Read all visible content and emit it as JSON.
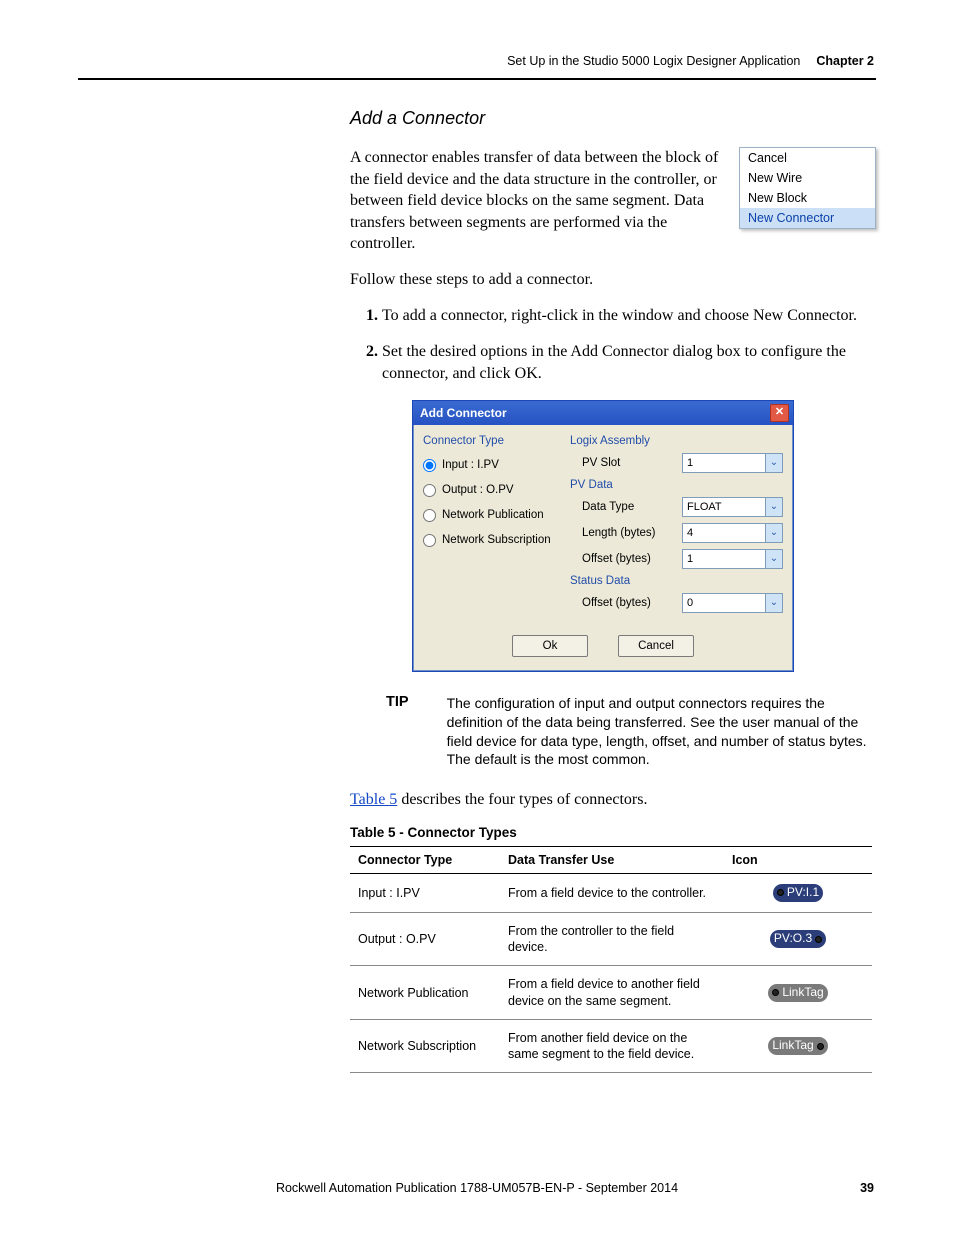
{
  "header": {
    "section": "Set Up in the Studio 5000 Logix Designer Application",
    "chapter": "Chapter 2"
  },
  "section_title": "Add a Connector",
  "intro": "A connector enables transfer of data between the block of the field device and the data structure in the controller, or between field device blocks on the same segment. Data transfers between segments are performed via the controller.",
  "follow": "Follow these steps to add a connector.",
  "context_menu": {
    "items": [
      "Cancel",
      "New Wire",
      "New Block",
      "New Connector"
    ],
    "selected_index": 3
  },
  "steps": [
    "To add a connector, right-click in the window and choose New Connector.",
    "Set the desired options in the Add Connector dialog box to configure the connector, and click OK."
  ],
  "dialog": {
    "title": "Add Connector",
    "connector_type_label": "Connector Type",
    "radios": [
      {
        "label": "Input : I.PV",
        "checked": true
      },
      {
        "label": "Output : O.PV",
        "checked": false
      },
      {
        "label": "Network Publication",
        "checked": false
      },
      {
        "label": "Network Subscription",
        "checked": false
      }
    ],
    "logix_assembly_label": "Logix Assembly",
    "pv_slot_label": "PV Slot",
    "pv_slot_value": "1",
    "pv_data_label": "PV Data",
    "data_type_label": "Data Type",
    "data_type_value": "FLOAT",
    "length_label": "Length (bytes)",
    "length_value": "4",
    "offset_label": "Offset (bytes)",
    "offset_value": "1",
    "status_data_label": "Status Data",
    "status_offset_label": "Offset (bytes)",
    "status_offset_value": "0",
    "ok_label": "Ok",
    "cancel_label": "Cancel"
  },
  "tip": {
    "label": "TIP",
    "body": "The configuration of input and output connectors requires the definition of the data being transferred. See the user manual of the field device for data type, length, offset, and number of status bytes. The default is the most common."
  },
  "table_ref_sentence_pre": "Table 5",
  "table_ref_sentence_post": " describes the four types of connectors.",
  "table_title": "Table 5 - Connector Types",
  "table": {
    "headers": [
      "Connector Type",
      "Data Transfer Use",
      "Icon"
    ],
    "rows": [
      {
        "type": "Input : I.PV",
        "use": "From a field device to the controller.",
        "icon_text": "PV:I.1",
        "icon_style": "navy",
        "dot_left": true,
        "dot_right": false
      },
      {
        "type": "Output : O.PV",
        "use": "From the controller to the field device.",
        "icon_text": "PV:O.3",
        "icon_style": "navy",
        "dot_left": false,
        "dot_right": true
      },
      {
        "type": "Network Publication",
        "use": "From a field device to another field device on the same segment.",
        "icon_text": "LinkTag",
        "icon_style": "grey",
        "dot_left": true,
        "dot_right": false
      },
      {
        "type": "Network Subscription",
        "use": "From another field device on the same segment to the field device.",
        "icon_text": "LinkTag",
        "icon_style": "grey",
        "dot_left": false,
        "dot_right": true
      }
    ]
  },
  "footer": {
    "publication": "Rockwell Automation Publication 1788-UM057B-EN-P - September 2014",
    "page": "39"
  }
}
